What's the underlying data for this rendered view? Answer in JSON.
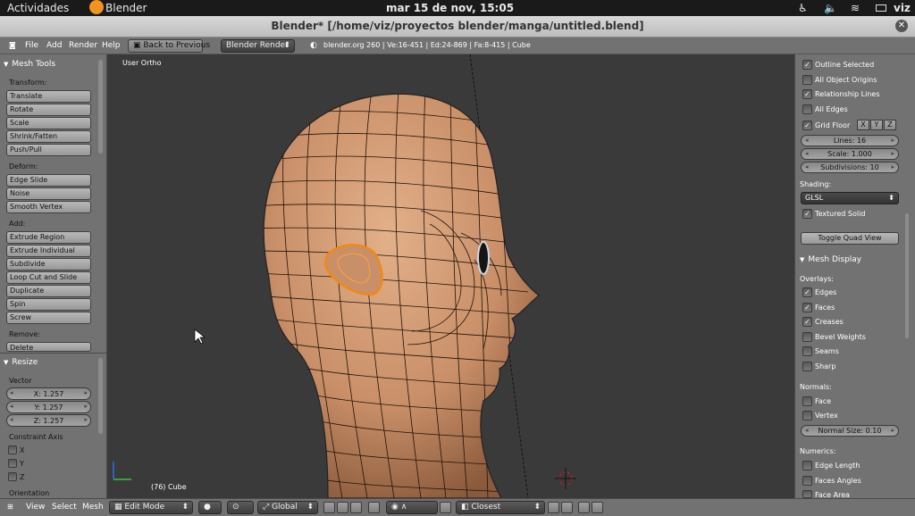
{
  "topbar": {
    "activities": "Actividades",
    "app": "Blender",
    "clock": "mar 15 de nov, 15:05",
    "user": "viz"
  },
  "window": {
    "title": "Blender* [/home/viz/proyectos blender/manga/untitled.blend]"
  },
  "menubar": {
    "file": "File",
    "add": "Add",
    "render": "Render",
    "help": "Help",
    "back_button": "Back to Previous",
    "render_engine": "Blender Render",
    "stats": "blender.org 260 | Ve:16-451 | Ed:24-869 | Fa:8-415 | Cube"
  },
  "left_panel": {
    "mesh_tools": "Mesh Tools",
    "transform_label": "Transform:",
    "transform": [
      "Translate",
      "Rotate",
      "Scale",
      "Shrink/Fatten",
      "Push/Pull"
    ],
    "deform_label": "Deform:",
    "deform": [
      "Edge Slide",
      "Noise",
      "Smooth Vertex"
    ],
    "add_label": "Add:",
    "add": [
      "Extrude Region",
      "Extrude Individual",
      "Subdivide",
      "Loop Cut and Slide",
      "Duplicate",
      "Spin",
      "Screw"
    ],
    "remove_label": "Remove:",
    "remove": [
      "Delete"
    ],
    "resize": "Resize",
    "vector_label": "Vector",
    "vector": {
      "x": "X: 1.257",
      "y": "Y: 1.257",
      "z": "Z: 1.257"
    },
    "constraint_label": "Constraint Axis",
    "constraint": [
      "X",
      "Y",
      "Z"
    ],
    "orientation_label": "Orientation"
  },
  "viewport": {
    "view_label": "User Ortho",
    "object_label": "(76) Cube",
    "skin_color": "#d29a72",
    "selection_color": "#f08a12"
  },
  "right_panel": {
    "outline_selected": "Outline Selected",
    "all_object_origins": "All Object Origins",
    "relationship_lines": "Relationship Lines",
    "all_edges": "All Edges",
    "grid_floor": "Grid Floor",
    "axes": [
      "X",
      "Y",
      "Z"
    ],
    "lines": "Lines: 16",
    "scale": "Scale: 1.000",
    "subdivisions": "Subdivisions: 10",
    "shading_label": "Shading:",
    "shading_value": "GLSL",
    "textured_solid": "Textured Solid",
    "toggle_quad_view": "Toggle Quad View",
    "mesh_display": "Mesh Display",
    "overlays_label": "Overlays:",
    "edges": "Edges",
    "faces": "Faces",
    "creases": "Creases",
    "bevel_weights": "Bevel Weights",
    "seams": "Seams",
    "sharp": "Sharp",
    "normals_label": "Normals:",
    "face": "Face",
    "vertex": "Vertex",
    "normal_size": "Normal Size: 0.10",
    "numerics_label": "Numerics:",
    "edge_length": "Edge Length",
    "faces_angles": "Faces Angles",
    "face_area": "Face Area"
  },
  "bottombar": {
    "view": "View",
    "select": "Select",
    "mesh": "Mesh",
    "mode": "Edit Mode",
    "orientation": "Global",
    "snap": "Closest"
  }
}
